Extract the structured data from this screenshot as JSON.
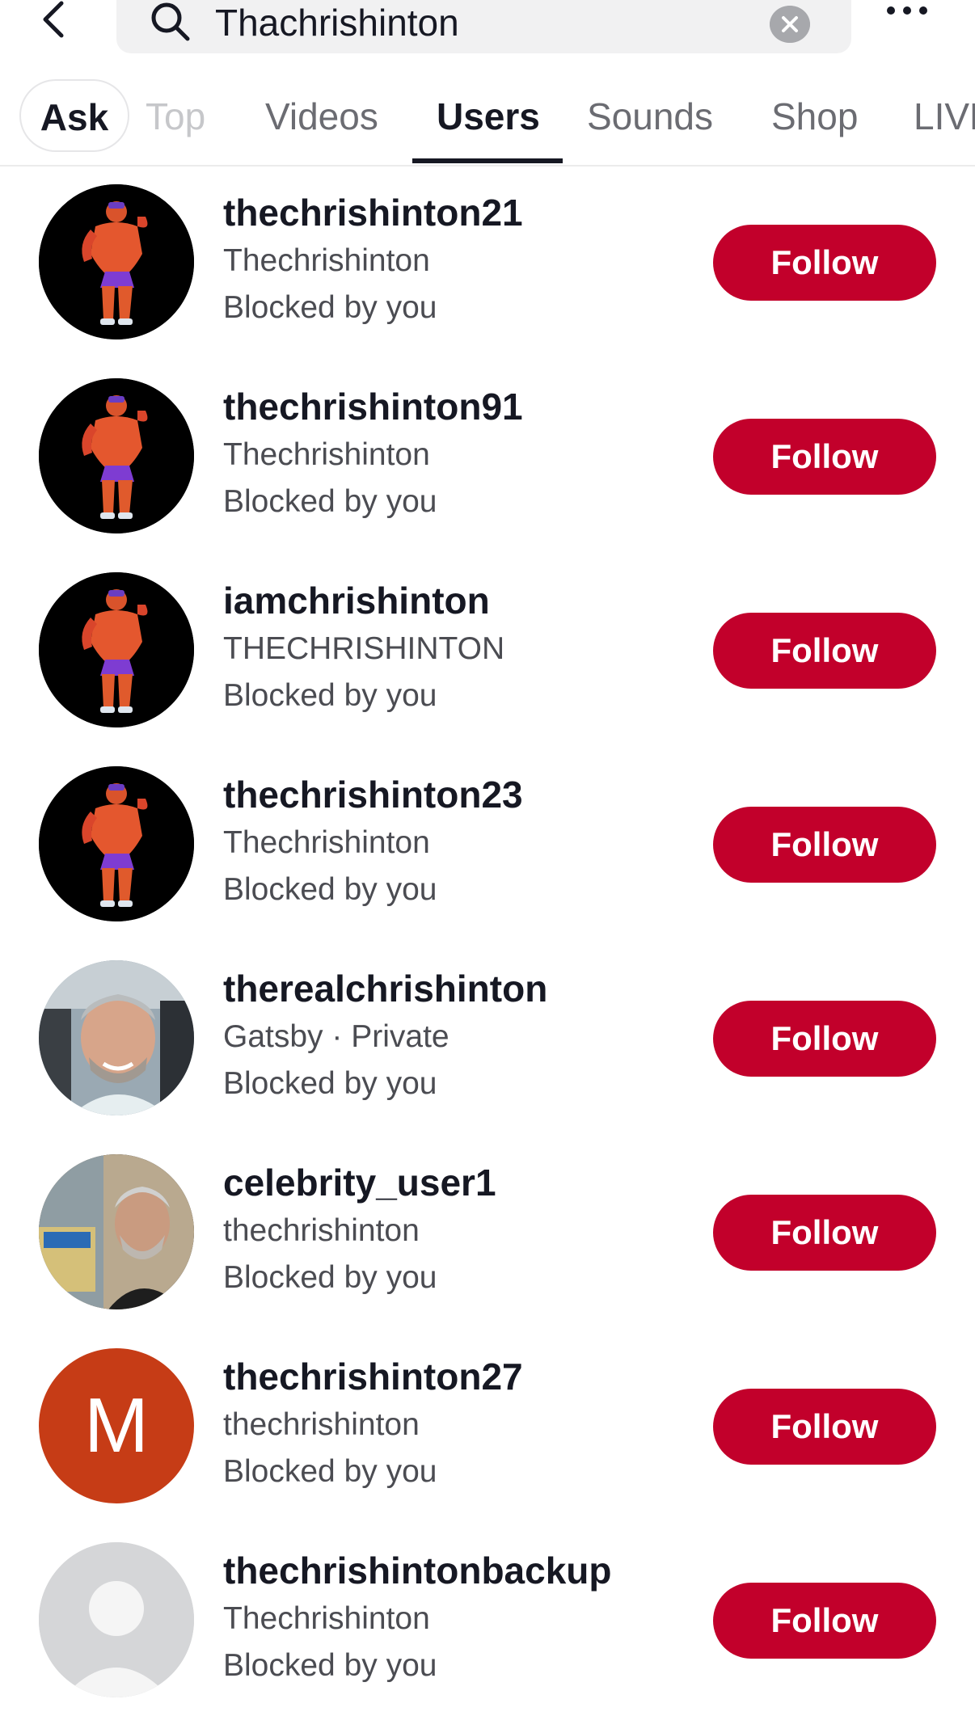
{
  "search": {
    "query": "Thachrishinton"
  },
  "tabs": [
    {
      "label": "Ask"
    },
    {
      "label": "Top"
    },
    {
      "label": "Videos"
    },
    {
      "label": "Users"
    },
    {
      "label": "Sounds"
    },
    {
      "label": "Shop"
    },
    {
      "label": "LIVE"
    }
  ],
  "active_tab": "Users",
  "results": [
    {
      "username": "thechrishinton21",
      "nickname": "Thechrishinton",
      "status": "Blocked by you",
      "button": "Follow",
      "avatar": "bodybuilder-icon"
    },
    {
      "username": "thechrishinton91",
      "nickname": "Thechrishinton",
      "status": "Blocked by you",
      "button": "Follow",
      "avatar": "bodybuilder-icon"
    },
    {
      "username": "iamchrishinton",
      "nickname": "THECHRISHINTON",
      "status": "Blocked by you",
      "button": "Follow",
      "avatar": "bodybuilder-icon"
    },
    {
      "username": "thechrishinton23",
      "nickname": "Thechrishinton",
      "status": "Blocked by you",
      "button": "Follow",
      "avatar": "bodybuilder-icon"
    },
    {
      "username": "therealchrishinton",
      "nickname": "Gatsby · Private",
      "status": "Blocked by you",
      "button": "Follow",
      "avatar": "photo-man-car-icon"
    },
    {
      "username": "celebrity_user1",
      "nickname": "thechrishinton",
      "status": "Blocked by you",
      "button": "Follow",
      "avatar": "photo-man-outdoor-icon"
    },
    {
      "username": "thechrishinton27",
      "nickname": "thechrishinton",
      "status": "Blocked by you",
      "button": "Follow",
      "avatar": "letter-avatar",
      "avatar_letter": "M",
      "avatar_color": "#c63c16"
    },
    {
      "username": "thechrishintonbackup",
      "nickname": "Thechrishinton",
      "status": "Blocked by you",
      "button": "Follow",
      "avatar": "default-avatar-icon"
    }
  ],
  "colors": {
    "follow": "#c2002b",
    "text": "#161823",
    "secondary": "#4b4c52"
  }
}
